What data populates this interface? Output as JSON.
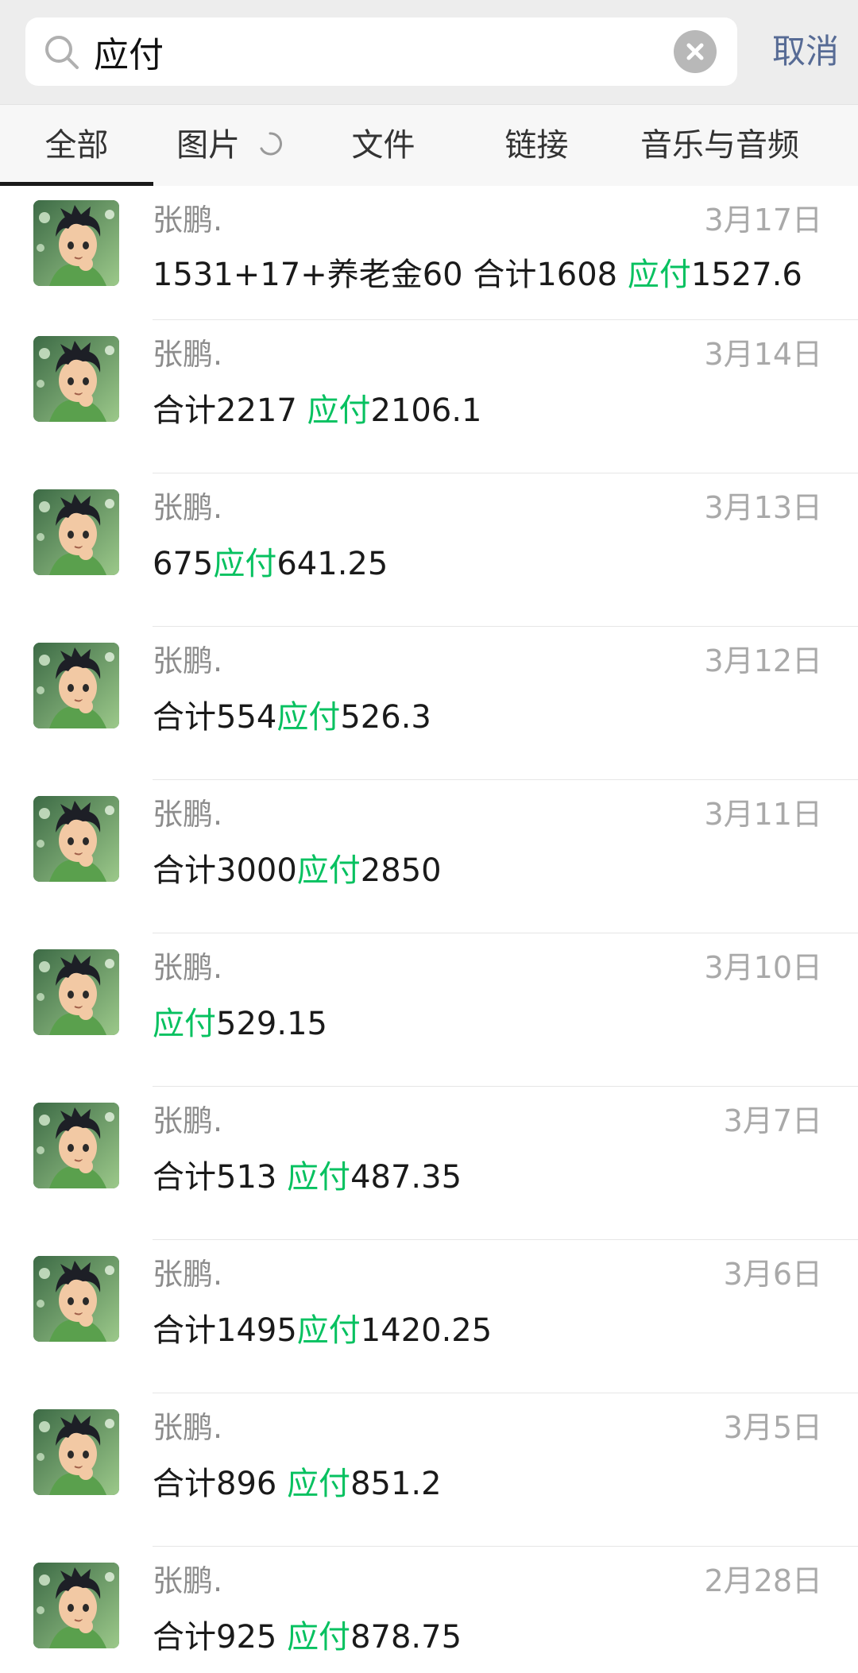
{
  "search": {
    "query": "应付",
    "cancel_label": "取消"
  },
  "tabs": [
    {
      "label": "全部",
      "active": true
    },
    {
      "label": "图片",
      "active": false,
      "loading": true
    },
    {
      "label": "文件",
      "active": false
    },
    {
      "label": "链接",
      "active": false
    },
    {
      "label": "音乐与音频",
      "active": false
    }
  ],
  "colors": {
    "highlight": "#07c160",
    "cancel": "#576b95"
  },
  "results": [
    {
      "name": "张鹏.",
      "date": "3月17日",
      "before": "1531+17+养老金60 合计1608 ",
      "keyword": "应付",
      "after": "1527.6"
    },
    {
      "name": "张鹏.",
      "date": "3月14日",
      "before": "合计2217 ",
      "keyword": "应付",
      "after": "2106.1"
    },
    {
      "name": "张鹏.",
      "date": "3月13日",
      "before": "675",
      "keyword": "应付",
      "after": "641.25"
    },
    {
      "name": "张鹏.",
      "date": "3月12日",
      "before": "合计554",
      "keyword": "应付",
      "after": "526.3"
    },
    {
      "name": "张鹏.",
      "date": "3月11日",
      "before": "合计3000",
      "keyword": "应付",
      "after": "2850"
    },
    {
      "name": "张鹏.",
      "date": "3月10日",
      "before": "",
      "keyword": "应付",
      "after": "529.15"
    },
    {
      "name": "张鹏.",
      "date": "3月7日",
      "before": "合计513 ",
      "keyword": "应付",
      "after": "487.35"
    },
    {
      "name": "张鹏.",
      "date": "3月6日",
      "before": "合计1495",
      "keyword": "应付",
      "after": "1420.25"
    },
    {
      "name": "张鹏.",
      "date": "3月5日",
      "before": "合计896 ",
      "keyword": "应付",
      "after": "851.2"
    },
    {
      "name": "张鹏.",
      "date": "2月28日",
      "before": "合计925 ",
      "keyword": "应付",
      "after": "878.75"
    }
  ]
}
